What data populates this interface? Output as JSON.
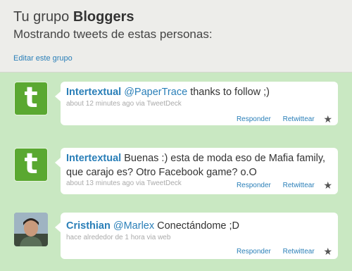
{
  "group": {
    "title_prefix": "Tu grupo",
    "title_name": "Bloggers",
    "subtitle": "Mostrando tweets de estas personas:",
    "edit_link": "Editar este grupo"
  },
  "actions": {
    "reply": "Responder",
    "retweet": "Retwittear"
  },
  "tweets": [
    {
      "user": "Intertextual",
      "mention": "@PaperTrace",
      "text": "thanks to follow ;)",
      "meta": "about 12 minutes ago via TweetDeck",
      "avatar": "twitter-t-logo"
    },
    {
      "user": "Intertextual",
      "mention": "",
      "text": "Buenas :) esta de moda eso de Mafia family, que carajo es? Otro Facebook game? o.O",
      "meta": "about 13 minutes ago via TweetDeck",
      "avatar": "twitter-t-logo"
    },
    {
      "user": "Cristhian",
      "mention": "@Marlex",
      "text": "Conectándome ;D",
      "meta": "hace alrededor de 1 hora via web",
      "avatar": "user-photo"
    }
  ],
  "colors": {
    "background": "#c9e8c2",
    "header": "#ededea",
    "link": "#2a7fb8",
    "avatar_green": "#5aa831"
  }
}
